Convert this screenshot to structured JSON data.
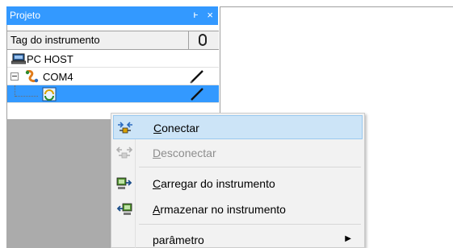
{
  "panel": {
    "title": "Projeto",
    "pin_glyph": "ͱ",
    "close_glyph": "×",
    "column_header": "Tag do instrumento",
    "column_icon": "cylinder-icon",
    "rows": [
      {
        "label": "PC HOST",
        "icon": "pc-host-icon"
      },
      {
        "label": "COM4",
        "icon": "com-port-icon",
        "expanded": true
      },
      {
        "label": "",
        "icon": "instrument-icon",
        "selected": true
      }
    ]
  },
  "context_menu": {
    "items": [
      {
        "first": "C",
        "rest": "onectar",
        "icon": "connect-icon",
        "enabled": true,
        "highlighted": true
      },
      {
        "first": "D",
        "rest": "esconectar",
        "icon": "disconnect-icon",
        "enabled": false
      },
      {
        "first": "C",
        "rest": "arregar do instrumento",
        "icon": "load-from-instrument-icon",
        "enabled": true
      },
      {
        "first": "A",
        "rest": "rmazenar no instrumento",
        "icon": "store-to-instrument-icon",
        "enabled": true
      },
      {
        "first": "",
        "rest": "parâmetro",
        "icon": "",
        "enabled": true,
        "submenu": true
      }
    ]
  },
  "colors": {
    "title_bar": "#3399ff",
    "selection": "#3399ff",
    "menu_highlight": "#cce4f7",
    "panel_bg": "#ababab"
  }
}
